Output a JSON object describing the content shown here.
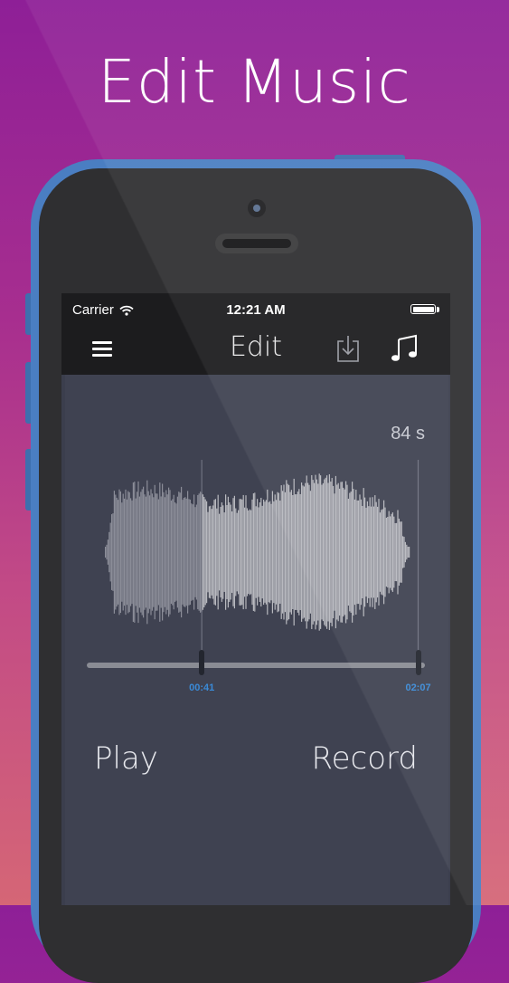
{
  "headline": "Edit Music",
  "status_bar": {
    "carrier": "Carrier",
    "time": "12:21 AM",
    "battery_level": 1.0
  },
  "nav_bar": {
    "title": "Edit",
    "left_icon": "hamburger-menu-icon",
    "right_icons": [
      "download-icon",
      "music-note-icon"
    ]
  },
  "editor": {
    "duration_label": "84 s",
    "start_time": "00:41",
    "end_time": "02:07",
    "selection_start_fraction": 0.34,
    "selection_end_fraction": 0.98
  },
  "actions": {
    "play": "Play",
    "record": "Record"
  },
  "colors": {
    "background_top": "#8e1f97",
    "background_bottom": "#d56676",
    "phone_frame": "#4a7ec2",
    "screen_bg": "#3f4251",
    "time_label": "#3a8ad7",
    "waveform_selected": "#b8b9bf",
    "waveform_unselected": "#8b8d98"
  }
}
